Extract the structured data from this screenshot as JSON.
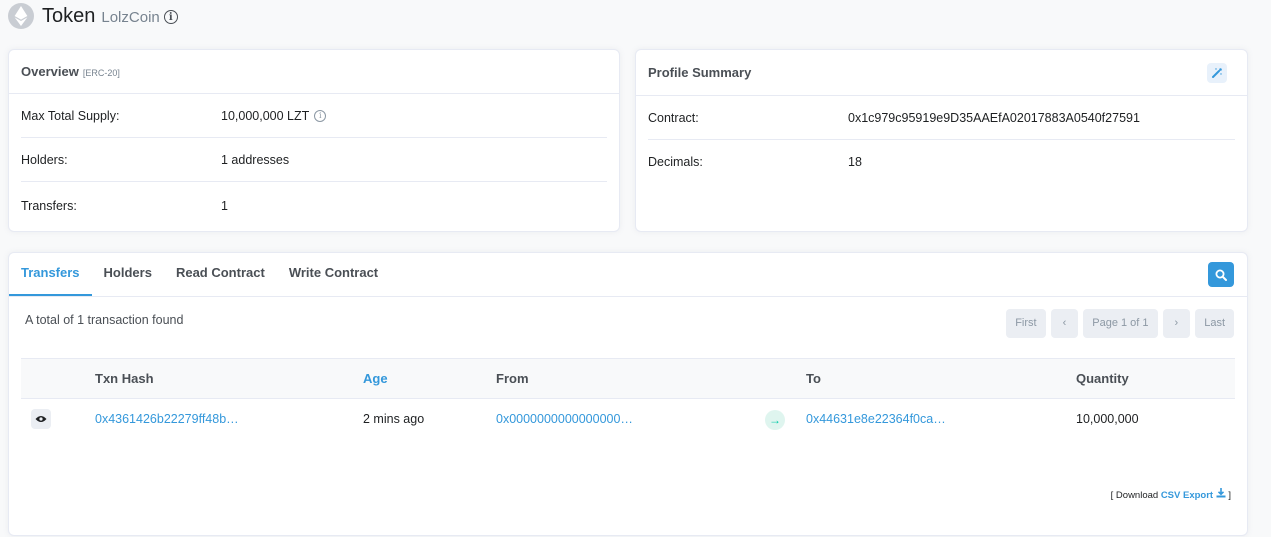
{
  "header": {
    "title": "Token",
    "token_name": "LolzCoin"
  },
  "overview": {
    "title": "Overview",
    "subtitle": "[ERC-20]",
    "rows": [
      {
        "label": "Max Total Supply:",
        "value": "10,000,000 LZT"
      },
      {
        "label": "Holders:",
        "value": "1 addresses"
      },
      {
        "label": "Transfers:",
        "value": "1"
      }
    ]
  },
  "profile": {
    "title": "Profile Summary",
    "rows": [
      {
        "label": "Contract:",
        "value": "0x1c979c95919e9D35AAEfA02017883A0540f27591"
      },
      {
        "label": "Decimals:",
        "value": "18"
      }
    ]
  },
  "tabs": [
    "Transfers",
    "Holders",
    "Read Contract",
    "Write Contract"
  ],
  "summary": "A total of 1 transaction found",
  "pager": {
    "first": "First",
    "prev": "‹",
    "page": "Page 1 of 1",
    "next": "›",
    "last": "Last"
  },
  "table": {
    "headers": [
      "Txn Hash",
      "Age",
      "From",
      "To",
      "Quantity"
    ],
    "rows": [
      {
        "hash": "0x4361426b22279ff48b…",
        "age": "2 mins ago",
        "from": "0x0000000000000000…",
        "to": "0x44631e8e22364f0ca…",
        "quantity": "10,000,000"
      }
    ]
  },
  "download": {
    "prefix": "[ Download",
    "link": "CSV Export",
    "suffix": "]"
  },
  "colors": {
    "accent": "#3498db",
    "success": "#00c9a7",
    "text": "#1e2022",
    "muted": "#77838f"
  }
}
